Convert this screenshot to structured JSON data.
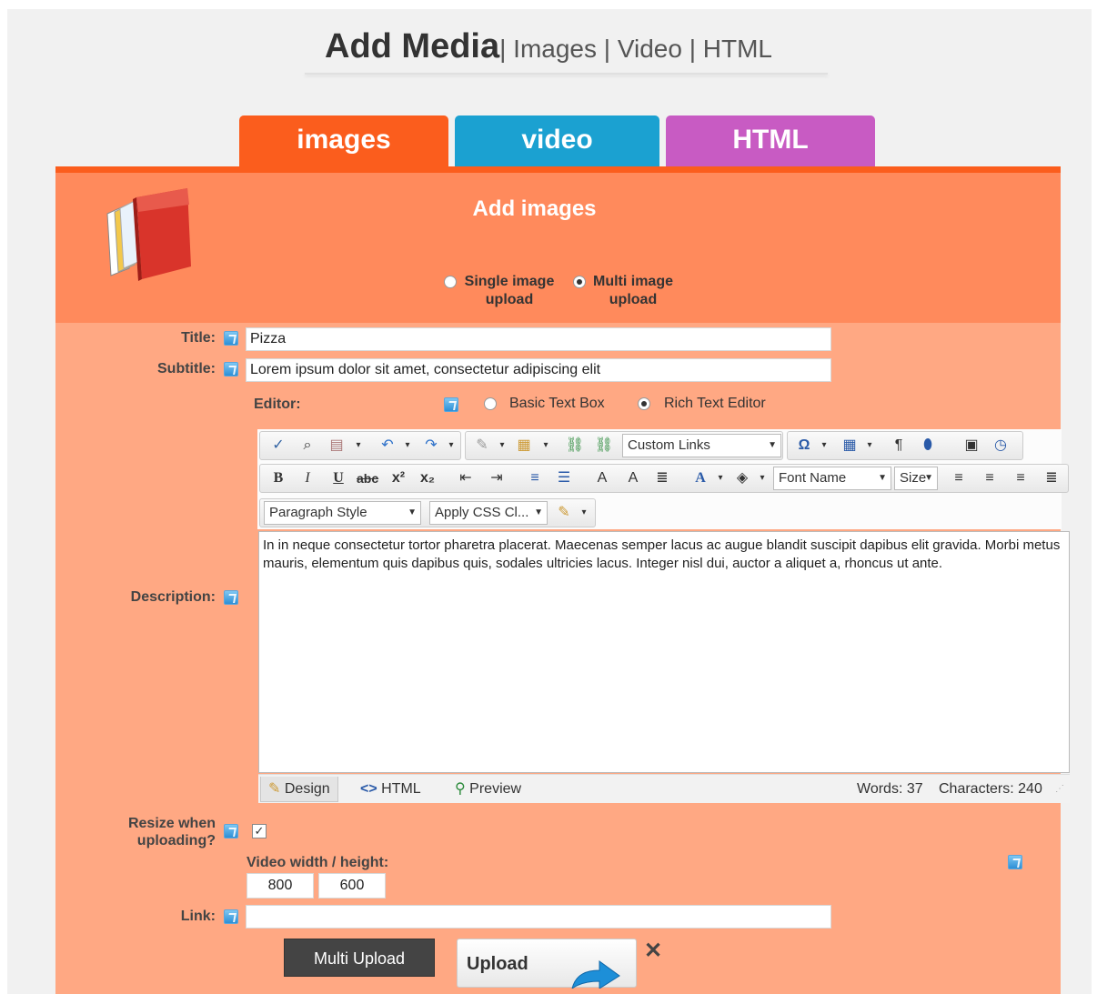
{
  "header": {
    "title": "Add Media",
    "links": "| Images | Video | HTML"
  },
  "tabs": [
    {
      "label": "images",
      "color": "#fb5d1d"
    },
    {
      "label": "video",
      "color": "#1ba1d1"
    },
    {
      "label": "HTML",
      "color": "#c85bc3"
    }
  ],
  "panel": {
    "title": "Add images",
    "upload_mode": {
      "single_label": "Single image upload",
      "multi_label": "Multi image upload",
      "selected": "multi"
    }
  },
  "form": {
    "title_label": "Title:",
    "title_value": "Pizza",
    "subtitle_label": "Subtitle:",
    "subtitle_value": "Lorem ipsum dolor sit amet, consectetur adipiscing elit",
    "editor_label": "Editor:",
    "editor_basic": "Basic Text Box",
    "editor_rich": "Rich Text Editor",
    "editor_selected": "rich",
    "description_label": "Description:",
    "resize_label": "Resize when uploading?",
    "resize_checked": true,
    "video_dims_label": "Video width / height:",
    "video_width": "800",
    "video_height": "600",
    "link_label": "Link:",
    "link_value": ""
  },
  "editor": {
    "custom_links": "Custom Links",
    "font_name": "Font Name",
    "size": "Size",
    "paragraph_style": "Paragraph Style",
    "apply_css": "Apply CSS Cl...",
    "content": "In in neque consectetur tortor pharetra placerat. Maecenas semper lacus ac augue blandit suscipit dapibus elit gravida. Morbi metus mauris, elementum quis dapibus quis, sodales ultricies lacus. Integer nisl dui, auctor a aliquet a, rhoncus ut ante.",
    "mode_design": "Design",
    "mode_html": "HTML",
    "mode_preview": "Preview",
    "words": "Words: 37",
    "characters": "Characters: 240"
  },
  "buttons": {
    "multi_upload": "Multi Upload",
    "upload": "Upload",
    "close": "✕"
  }
}
